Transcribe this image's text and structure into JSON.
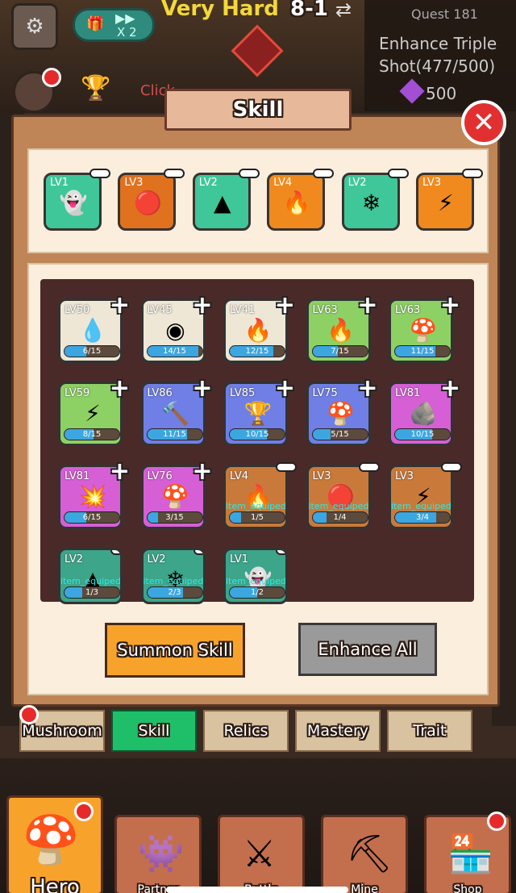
{
  "header": {
    "difficulty": "Very Hard",
    "stage": "8-1",
    "speed_label": "X 2",
    "quest_number": "Quest 181",
    "quest_text_line1": "Enhance Triple",
    "quest_text_line2": "Shot(477/500)",
    "quest_reward": "500",
    "behind_text": "Click"
  },
  "dialog": {
    "title": "Skill",
    "equipped": [
      {
        "lv": "LV1",
        "icon": "ghost-icon",
        "color": "#3fc79a"
      },
      {
        "lv": "LV3",
        "icon": "fireball-icon",
        "color": "#e0711f"
      },
      {
        "lv": "LV2",
        "icon": "triangle-icon",
        "color": "#3fc79a"
      },
      {
        "lv": "LV4",
        "icon": "fire-icon",
        "color": "#f08a1e"
      },
      {
        "lv": "LV2",
        "icon": "snowflake-icon",
        "color": "#3fc79a"
      },
      {
        "lv": "LV3",
        "icon": "lightning-icon",
        "color": "#f08a1e"
      }
    ],
    "skills": [
      {
        "lv": "LV50",
        "progress": "6/15",
        "frac": 0.4,
        "icon": "water-drop-icon",
        "color": "#efe7d6",
        "action": "plus"
      },
      {
        "lv": "LV45",
        "progress": "14/15",
        "frac": 0.93,
        "icon": "orb-icon",
        "color": "#efe7d6",
        "action": "plus"
      },
      {
        "lv": "LV41",
        "progress": "12/15",
        "frac": 0.8,
        "icon": "flame-bowl-icon",
        "color": "#efe7d6",
        "action": "plus"
      },
      {
        "lv": "LV63",
        "progress": "7/15",
        "frac": 0.47,
        "icon": "red-flame-icon",
        "color": "#8dd164",
        "action": "plus"
      },
      {
        "lv": "LV63",
        "progress": "11/15",
        "frac": 0.73,
        "icon": "mushrooms-icon",
        "color": "#8dd164",
        "action": "plus"
      },
      {
        "lv": "LV59",
        "progress": "8/15",
        "frac": 0.53,
        "icon": "lightning-bolt-icon",
        "color": "#8dd164",
        "action": "plus"
      },
      {
        "lv": "LV86",
        "progress": "11/15",
        "frac": 0.73,
        "icon": "hammer-icon",
        "color": "#6f7fe6",
        "action": "plus"
      },
      {
        "lv": "LV85",
        "progress": "10/15",
        "frac": 0.67,
        "icon": "cup-icon",
        "color": "#6f7fe6",
        "action": "plus"
      },
      {
        "lv": "LV75",
        "progress": "5/15",
        "frac": 0.33,
        "icon": "mushroom-pair-icon",
        "color": "#6f7fe6",
        "action": "plus"
      },
      {
        "lv": "LV81",
        "progress": "10/15",
        "frac": 0.67,
        "icon": "rocks-icon",
        "color": "#d65fd6",
        "action": "plus"
      },
      {
        "lv": "LV81",
        "progress": "6/15",
        "frac": 0.4,
        "icon": "explosion-icon",
        "color": "#d65fd6",
        "action": "plus"
      },
      {
        "lv": "LV76",
        "progress": "3/15",
        "frac": 0.2,
        "icon": "mushroom-icon",
        "color": "#d65fd6",
        "action": "plus"
      },
      {
        "lv": "LV4",
        "progress": "1/5",
        "frac": 0.2,
        "icon": "fire-icon",
        "color": "#c97a3a",
        "action": "minus",
        "equipped": "item_equiped"
      },
      {
        "lv": "LV3",
        "progress": "1/4",
        "frac": 0.25,
        "icon": "fireball-icon",
        "color": "#c97a3a",
        "action": "minus",
        "equipped": "item_equiped"
      },
      {
        "lv": "LV3",
        "progress": "3/4",
        "frac": 0.75,
        "icon": "lightning-icon",
        "color": "#c97a3a",
        "action": "minus",
        "equipped": "item_equiped"
      },
      {
        "lv": "LV2",
        "progress": "1/3",
        "frac": 0.33,
        "icon": "triangle-icon",
        "color": "#3ca58a",
        "action": "minus",
        "equipped": "item_equiped"
      },
      {
        "lv": "LV2",
        "progress": "2/3",
        "frac": 0.66,
        "icon": "snowflake-icon",
        "color": "#3ca58a",
        "action": "minus",
        "equipped": "item_equiped"
      },
      {
        "lv": "LV1",
        "progress": "1/2",
        "frac": 0.5,
        "icon": "ghost-icon",
        "color": "#3ca58a",
        "action": "minus",
        "equipped": "item_equiped"
      }
    ],
    "summon_label": "Summon Skill",
    "enhance_label": "Enhance All"
  },
  "tabs": [
    "Mushroom",
    "Skill",
    "Relics",
    "Mastery",
    "Trait"
  ],
  "nav": [
    "Hero",
    "Partner",
    "Battle",
    "Mine",
    "Shop"
  ],
  "colors": {
    "accent_orange": "#f7a32b",
    "active_tab": "#1fbf6a",
    "badge": "#e62a2a"
  }
}
